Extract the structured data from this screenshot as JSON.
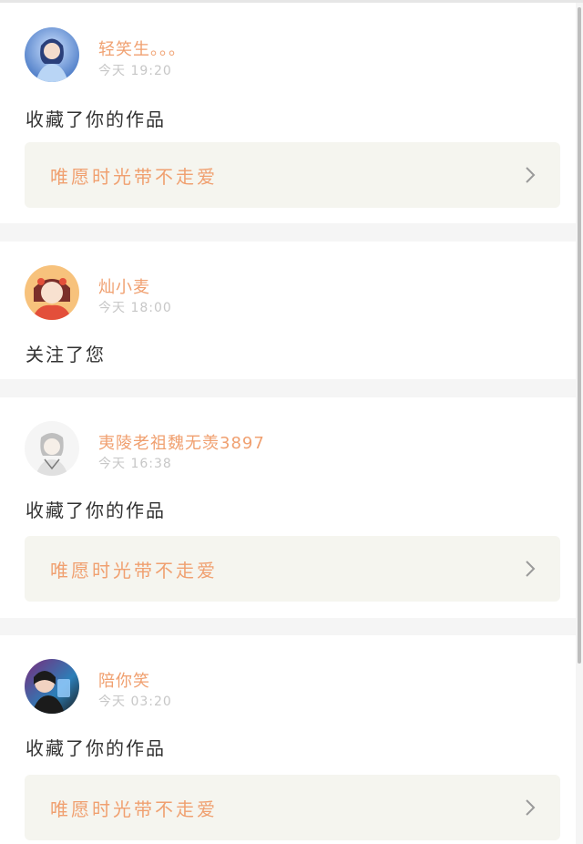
{
  "notifications": [
    {
      "username": "轻笑生。。。",
      "time": "今天 19:20",
      "action": "收藏了你的作品",
      "work_title": "唯愿时光带不走爱",
      "avatar_colors": [
        "#4d7cc7",
        "#b9d5f5",
        "#2a3f7a"
      ]
    },
    {
      "username": "灿小麦",
      "time": "今天 18:00",
      "action": "关注了您",
      "avatar_colors": [
        "#e34f3a",
        "#f7c27c",
        "#7b2f2a"
      ]
    },
    {
      "username": "夷陵老祖魏无羡3897",
      "time": "今天 16:38",
      "action": "收藏了你的作品",
      "work_title": "唯愿时光带不走爱",
      "avatar_colors": [
        "#e9e9e9",
        "#bfbfbf",
        "#7a7a7a"
      ]
    },
    {
      "username": "陪你笑",
      "time": "今天 03:20",
      "action": "收藏了你的作品",
      "work_title": "唯愿时光带不走爱",
      "avatar_colors": [
        "#7a2b7b",
        "#2c7fb8",
        "#1b1b1b"
      ]
    }
  ],
  "colors": {
    "accent": "#f0a070",
    "card_background": "#ffffff",
    "page_background": "#f5f5f5",
    "link_background": "#f5f5ef",
    "time_text": "#c7c7c7",
    "action_text": "#333333"
  },
  "icons": {
    "chevron": "chevron-right-icon"
  }
}
